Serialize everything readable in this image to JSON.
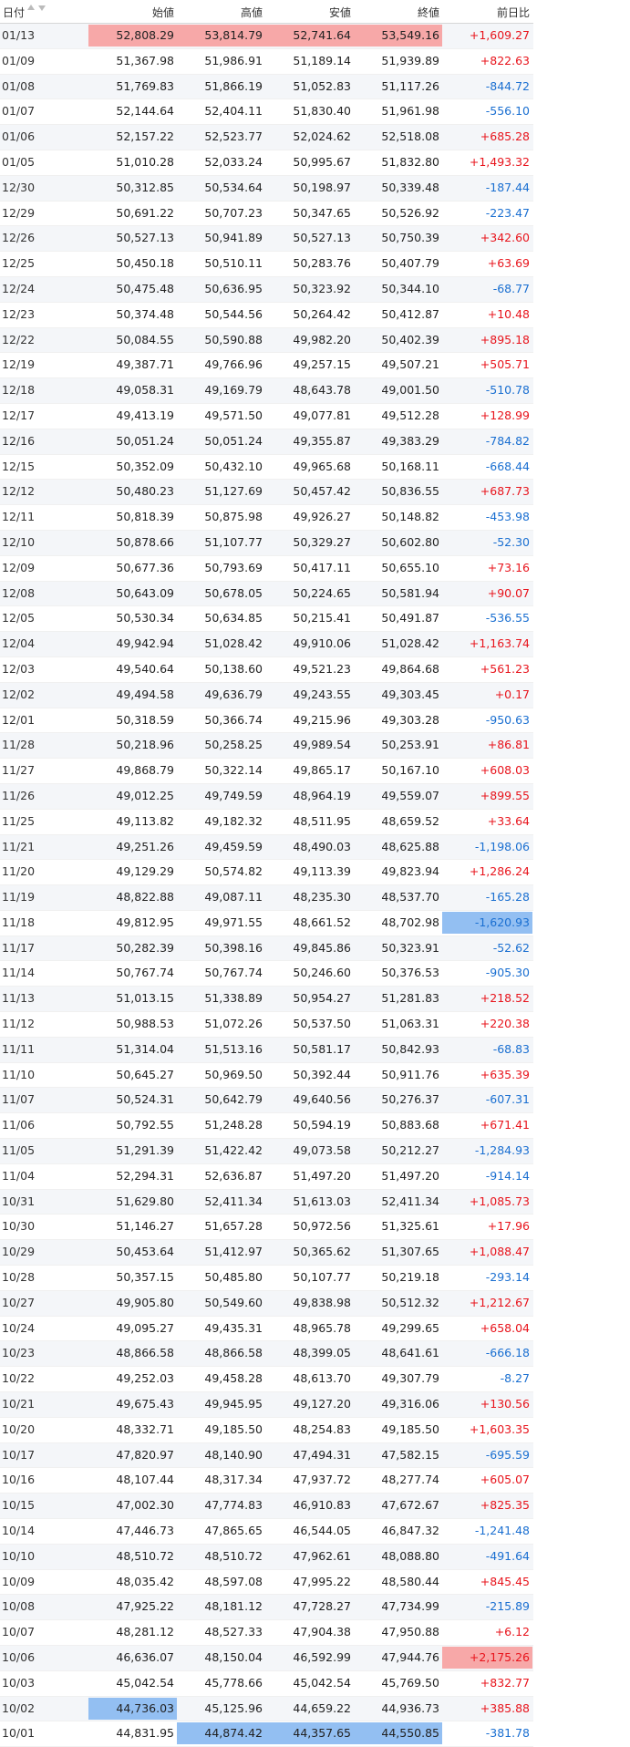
{
  "table": {
    "headers": {
      "date": "日付",
      "open": "始値",
      "high": "高値",
      "low": "安値",
      "close": "終値",
      "change": "前日比"
    },
    "colors": {
      "up": "#e8141c",
      "down": "#1a6fd1",
      "highlight_high": "#f7a8a8",
      "highlight_low": "#93bff2"
    },
    "rows": [
      {
        "date": "01/13",
        "open": "52,808.29",
        "high": "53,814.79",
        "low": "52,741.64",
        "close": "53,549.16",
        "change": "+1,609.27",
        "dir": "up",
        "hl": {
          "open": "red",
          "high": "red",
          "low": "red",
          "close": "red"
        }
      },
      {
        "date": "01/09",
        "open": "51,367.98",
        "high": "51,986.91",
        "low": "51,189.14",
        "close": "51,939.89",
        "change": "+822.63",
        "dir": "up"
      },
      {
        "date": "01/08",
        "open": "51,769.83",
        "high": "51,866.19",
        "low": "51,052.83",
        "close": "51,117.26",
        "change": "-844.72",
        "dir": "down"
      },
      {
        "date": "01/07",
        "open": "52,144.64",
        "high": "52,404.11",
        "low": "51,830.40",
        "close": "51,961.98",
        "change": "-556.10",
        "dir": "down"
      },
      {
        "date": "01/06",
        "open": "52,157.22",
        "high": "52,523.77",
        "low": "52,024.62",
        "close": "52,518.08",
        "change": "+685.28",
        "dir": "up"
      },
      {
        "date": "01/05",
        "open": "51,010.28",
        "high": "52,033.24",
        "low": "50,995.67",
        "close": "51,832.80",
        "change": "+1,493.32",
        "dir": "up"
      },
      {
        "date": "12/30",
        "open": "50,312.85",
        "high": "50,534.64",
        "low": "50,198.97",
        "close": "50,339.48",
        "change": "-187.44",
        "dir": "down"
      },
      {
        "date": "12/29",
        "open": "50,691.22",
        "high": "50,707.23",
        "low": "50,347.65",
        "close": "50,526.92",
        "change": "-223.47",
        "dir": "down"
      },
      {
        "date": "12/26",
        "open": "50,527.13",
        "high": "50,941.89",
        "low": "50,527.13",
        "close": "50,750.39",
        "change": "+342.60",
        "dir": "up"
      },
      {
        "date": "12/25",
        "open": "50,450.18",
        "high": "50,510.11",
        "low": "50,283.76",
        "close": "50,407.79",
        "change": "+63.69",
        "dir": "up"
      },
      {
        "date": "12/24",
        "open": "50,475.48",
        "high": "50,636.95",
        "low": "50,323.92",
        "close": "50,344.10",
        "change": "-68.77",
        "dir": "down"
      },
      {
        "date": "12/23",
        "open": "50,374.48",
        "high": "50,544.56",
        "low": "50,264.42",
        "close": "50,412.87",
        "change": "+10.48",
        "dir": "up"
      },
      {
        "date": "12/22",
        "open": "50,084.55",
        "high": "50,590.88",
        "low": "49,982.20",
        "close": "50,402.39",
        "change": "+895.18",
        "dir": "up"
      },
      {
        "date": "12/19",
        "open": "49,387.71",
        "high": "49,766.96",
        "low": "49,257.15",
        "close": "49,507.21",
        "change": "+505.71",
        "dir": "up"
      },
      {
        "date": "12/18",
        "open": "49,058.31",
        "high": "49,169.79",
        "low": "48,643.78",
        "close": "49,001.50",
        "change": "-510.78",
        "dir": "down"
      },
      {
        "date": "12/17",
        "open": "49,413.19",
        "high": "49,571.50",
        "low": "49,077.81",
        "close": "49,512.28",
        "change": "+128.99",
        "dir": "up"
      },
      {
        "date": "12/16",
        "open": "50,051.24",
        "high": "50,051.24",
        "low": "49,355.87",
        "close": "49,383.29",
        "change": "-784.82",
        "dir": "down"
      },
      {
        "date": "12/15",
        "open": "50,352.09",
        "high": "50,432.10",
        "low": "49,965.68",
        "close": "50,168.11",
        "change": "-668.44",
        "dir": "down"
      },
      {
        "date": "12/12",
        "open": "50,480.23",
        "high": "51,127.69",
        "low": "50,457.42",
        "close": "50,836.55",
        "change": "+687.73",
        "dir": "up"
      },
      {
        "date": "12/11",
        "open": "50,818.39",
        "high": "50,875.98",
        "low": "49,926.27",
        "close": "50,148.82",
        "change": "-453.98",
        "dir": "down"
      },
      {
        "date": "12/10",
        "open": "50,878.66",
        "high": "51,107.77",
        "low": "50,329.27",
        "close": "50,602.80",
        "change": "-52.30",
        "dir": "down"
      },
      {
        "date": "12/09",
        "open": "50,677.36",
        "high": "50,793.69",
        "low": "50,417.11",
        "close": "50,655.10",
        "change": "+73.16",
        "dir": "up"
      },
      {
        "date": "12/08",
        "open": "50,643.09",
        "high": "50,678.05",
        "low": "50,224.65",
        "close": "50,581.94",
        "change": "+90.07",
        "dir": "up"
      },
      {
        "date": "12/05",
        "open": "50,530.34",
        "high": "50,634.85",
        "low": "50,215.41",
        "close": "50,491.87",
        "change": "-536.55",
        "dir": "down"
      },
      {
        "date": "12/04",
        "open": "49,942.94",
        "high": "51,028.42",
        "low": "49,910.06",
        "close": "51,028.42",
        "change": "+1,163.74",
        "dir": "up"
      },
      {
        "date": "12/03",
        "open": "49,540.64",
        "high": "50,138.60",
        "low": "49,521.23",
        "close": "49,864.68",
        "change": "+561.23",
        "dir": "up"
      },
      {
        "date": "12/02",
        "open": "49,494.58",
        "high": "49,636.79",
        "low": "49,243.55",
        "close": "49,303.45",
        "change": "+0.17",
        "dir": "up"
      },
      {
        "date": "12/01",
        "open": "50,318.59",
        "high": "50,366.74",
        "low": "49,215.96",
        "close": "49,303.28",
        "change": "-950.63",
        "dir": "down"
      },
      {
        "date": "11/28",
        "open": "50,218.96",
        "high": "50,258.25",
        "low": "49,989.54",
        "close": "50,253.91",
        "change": "+86.81",
        "dir": "up"
      },
      {
        "date": "11/27",
        "open": "49,868.79",
        "high": "50,322.14",
        "low": "49,865.17",
        "close": "50,167.10",
        "change": "+608.03",
        "dir": "up"
      },
      {
        "date": "11/26",
        "open": "49,012.25",
        "high": "49,749.59",
        "low": "48,964.19",
        "close": "49,559.07",
        "change": "+899.55",
        "dir": "up"
      },
      {
        "date": "11/25",
        "open": "49,113.82",
        "high": "49,182.32",
        "low": "48,511.95",
        "close": "48,659.52",
        "change": "+33.64",
        "dir": "up"
      },
      {
        "date": "11/21",
        "open": "49,251.26",
        "high": "49,459.59",
        "low": "48,490.03",
        "close": "48,625.88",
        "change": "-1,198.06",
        "dir": "down"
      },
      {
        "date": "11/20",
        "open": "49,129.29",
        "high": "50,574.82",
        "low": "49,113.39",
        "close": "49,823.94",
        "change": "+1,286.24",
        "dir": "up"
      },
      {
        "date": "11/19",
        "open": "48,822.88",
        "high": "49,087.11",
        "low": "48,235.30",
        "close": "48,537.70",
        "change": "-165.28",
        "dir": "down"
      },
      {
        "date": "11/18",
        "open": "49,812.95",
        "high": "49,971.55",
        "low": "48,661.52",
        "close": "48,702.98",
        "change": "-1,620.93",
        "dir": "down",
        "hl": {
          "change": "blue"
        }
      },
      {
        "date": "11/17",
        "open": "50,282.39",
        "high": "50,398.16",
        "low": "49,845.86",
        "close": "50,323.91",
        "change": "-52.62",
        "dir": "down"
      },
      {
        "date": "11/14",
        "open": "50,767.74",
        "high": "50,767.74",
        "low": "50,246.60",
        "close": "50,376.53",
        "change": "-905.30",
        "dir": "down"
      },
      {
        "date": "11/13",
        "open": "51,013.15",
        "high": "51,338.89",
        "low": "50,954.27",
        "close": "51,281.83",
        "change": "+218.52",
        "dir": "up"
      },
      {
        "date": "11/12",
        "open": "50,988.53",
        "high": "51,072.26",
        "low": "50,537.50",
        "close": "51,063.31",
        "change": "+220.38",
        "dir": "up"
      },
      {
        "date": "11/11",
        "open": "51,314.04",
        "high": "51,513.16",
        "low": "50,581.17",
        "close": "50,842.93",
        "change": "-68.83",
        "dir": "down"
      },
      {
        "date": "11/10",
        "open": "50,645.27",
        "high": "50,969.50",
        "low": "50,392.44",
        "close": "50,911.76",
        "change": "+635.39",
        "dir": "up"
      },
      {
        "date": "11/07",
        "open": "50,524.31",
        "high": "50,642.79",
        "low": "49,640.56",
        "close": "50,276.37",
        "change": "-607.31",
        "dir": "down"
      },
      {
        "date": "11/06",
        "open": "50,792.55",
        "high": "51,248.28",
        "low": "50,594.19",
        "close": "50,883.68",
        "change": "+671.41",
        "dir": "up"
      },
      {
        "date": "11/05",
        "open": "51,291.39",
        "high": "51,422.42",
        "low": "49,073.58",
        "close": "50,212.27",
        "change": "-1,284.93",
        "dir": "down"
      },
      {
        "date": "11/04",
        "open": "52,294.31",
        "high": "52,636.87",
        "low": "51,497.20",
        "close": "51,497.20",
        "change": "-914.14",
        "dir": "down"
      },
      {
        "date": "10/31",
        "open": "51,629.80",
        "high": "52,411.34",
        "low": "51,613.03",
        "close": "52,411.34",
        "change": "+1,085.73",
        "dir": "up"
      },
      {
        "date": "10/30",
        "open": "51,146.27",
        "high": "51,657.28",
        "low": "50,972.56",
        "close": "51,325.61",
        "change": "+17.96",
        "dir": "up"
      },
      {
        "date": "10/29",
        "open": "50,453.64",
        "high": "51,412.97",
        "low": "50,365.62",
        "close": "51,307.65",
        "change": "+1,088.47",
        "dir": "up"
      },
      {
        "date": "10/28",
        "open": "50,357.15",
        "high": "50,485.80",
        "low": "50,107.77",
        "close": "50,219.18",
        "change": "-293.14",
        "dir": "down"
      },
      {
        "date": "10/27",
        "open": "49,905.80",
        "high": "50,549.60",
        "low": "49,838.98",
        "close": "50,512.32",
        "change": "+1,212.67",
        "dir": "up"
      },
      {
        "date": "10/24",
        "open": "49,095.27",
        "high": "49,435.31",
        "low": "48,965.78",
        "close": "49,299.65",
        "change": "+658.04",
        "dir": "up"
      },
      {
        "date": "10/23",
        "open": "48,866.58",
        "high": "48,866.58",
        "low": "48,399.05",
        "close": "48,641.61",
        "change": "-666.18",
        "dir": "down"
      },
      {
        "date": "10/22",
        "open": "49,252.03",
        "high": "49,458.28",
        "low": "48,613.70",
        "close": "49,307.79",
        "change": "-8.27",
        "dir": "down"
      },
      {
        "date": "10/21",
        "open": "49,675.43",
        "high": "49,945.95",
        "low": "49,127.20",
        "close": "49,316.06",
        "change": "+130.56",
        "dir": "up"
      },
      {
        "date": "10/20",
        "open": "48,332.71",
        "high": "49,185.50",
        "low": "48,254.83",
        "close": "49,185.50",
        "change": "+1,603.35",
        "dir": "up"
      },
      {
        "date": "10/17",
        "open": "47,820.97",
        "high": "48,140.90",
        "low": "47,494.31",
        "close": "47,582.15",
        "change": "-695.59",
        "dir": "down"
      },
      {
        "date": "10/16",
        "open": "48,107.44",
        "high": "48,317.34",
        "low": "47,937.72",
        "close": "48,277.74",
        "change": "+605.07",
        "dir": "up"
      },
      {
        "date": "10/15",
        "open": "47,002.30",
        "high": "47,774.83",
        "low": "46,910.83",
        "close": "47,672.67",
        "change": "+825.35",
        "dir": "up"
      },
      {
        "date": "10/14",
        "open": "47,446.73",
        "high": "47,865.65",
        "low": "46,544.05",
        "close": "46,847.32",
        "change": "-1,241.48",
        "dir": "down"
      },
      {
        "date": "10/10",
        "open": "48,510.72",
        "high": "48,510.72",
        "low": "47,962.61",
        "close": "48,088.80",
        "change": "-491.64",
        "dir": "down"
      },
      {
        "date": "10/09",
        "open": "48,035.42",
        "high": "48,597.08",
        "low": "47,995.22",
        "close": "48,580.44",
        "change": "+845.45",
        "dir": "up"
      },
      {
        "date": "10/08",
        "open": "47,925.22",
        "high": "48,181.12",
        "low": "47,728.27",
        "close": "47,734.99",
        "change": "-215.89",
        "dir": "down"
      },
      {
        "date": "10/07",
        "open": "48,281.12",
        "high": "48,527.33",
        "low": "47,904.38",
        "close": "47,950.88",
        "change": "+6.12",
        "dir": "up"
      },
      {
        "date": "10/06",
        "open": "46,636.07",
        "high": "48,150.04",
        "low": "46,592.99",
        "close": "47,944.76",
        "change": "+2,175.26",
        "dir": "up",
        "hl": {
          "change": "red"
        }
      },
      {
        "date": "10/03",
        "open": "45,042.54",
        "high": "45,778.66",
        "low": "45,042.54",
        "close": "45,769.50",
        "change": "+832.77",
        "dir": "up"
      },
      {
        "date": "10/02",
        "open": "44,736.03",
        "high": "45,125.96",
        "low": "44,659.22",
        "close": "44,936.73",
        "change": "+385.88",
        "dir": "up",
        "hl": {
          "open": "blue"
        }
      },
      {
        "date": "10/01",
        "open": "44,831.95",
        "high": "44,874.42",
        "low": "44,357.65",
        "close": "44,550.85",
        "change": "-381.78",
        "dir": "down",
        "hl": {
          "high": "blue",
          "low": "blue",
          "close": "blue"
        }
      }
    ]
  }
}
